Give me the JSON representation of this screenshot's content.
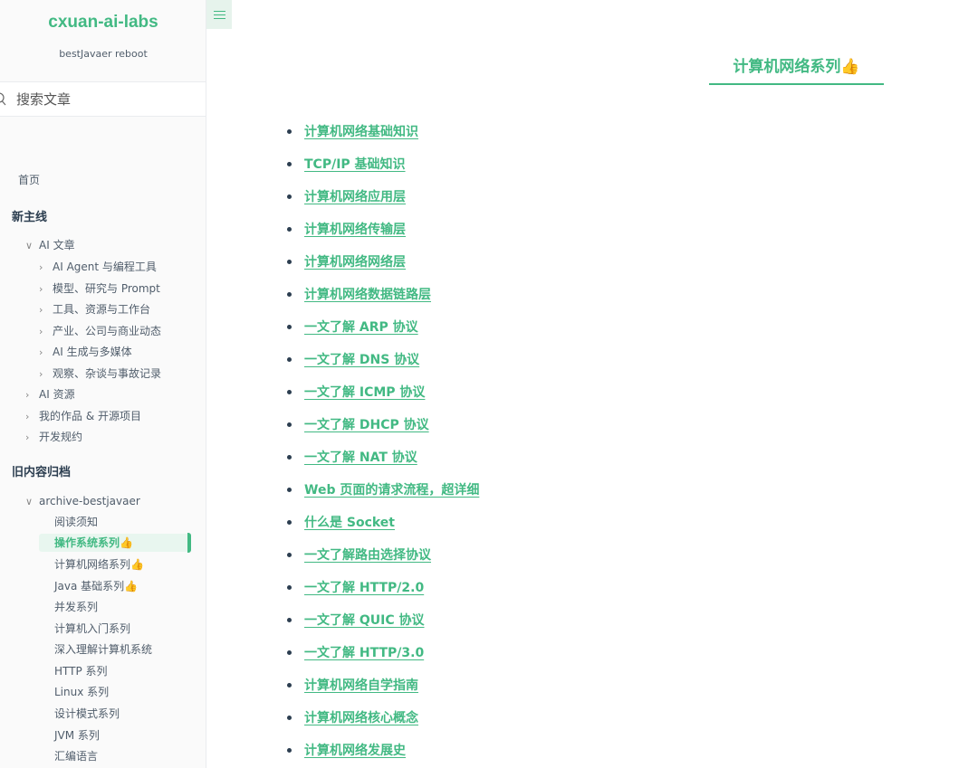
{
  "sidebar": {
    "brand": "cxuan-ai-labs",
    "subtitle": "bestJavaer reboot",
    "search_placeholder": "搜索文章",
    "home": "首页",
    "section_main": "新主线",
    "ai_articles": "AI 文章",
    "ai_sub": [
      "AI Agent 与编程工具",
      "模型、研究与 Prompt",
      "工具、资源与工作台",
      "产业、公司与商业动态",
      "AI 生成与多媒体",
      "观察、杂谈与事故记录"
    ],
    "ai_resources": "AI 资源",
    "my_works": "我的作品 & 开源项目",
    "dev_rules": "开发规约",
    "section_archive": "旧内容归档",
    "archive_name": "archive-bestjavaer",
    "archive_items": [
      "阅读须知",
      "操作系统系列👍",
      "计算机网络系列👍",
      "Java 基础系列👍",
      "并发系列",
      "计算机入门系列",
      "深入理解计算机系统",
      "HTTP 系列",
      "Linux 系列",
      "设计模式系列",
      "JVM 系列",
      "汇编语言"
    ]
  },
  "main": {
    "title": "计算机网络系列👍",
    "articles": [
      "计算机网络基础知识",
      "TCP/IP 基础知识",
      "计算机网络应用层",
      "计算机网络传输层",
      "计算机网络网络层",
      "计算机网络数据链路层",
      "一文了解 ARP 协议",
      "一文了解 DNS 协议",
      "一文了解 ICMP 协议",
      "一文了解 DHCP 协议",
      "一文了解 NAT 协议",
      "Web 页面的请求流程，超详细",
      "什么是 Socket",
      "一文了解路由选择协议",
      "一文了解 HTTP/2.0",
      "一文了解 QUIC 协议",
      "一文了解 HTTP/3.0",
      "计算机网络自学指南",
      "计算机网络核心概念",
      "计算机网络发展史"
    ]
  },
  "colors": {
    "accent": "#42b983",
    "text": "#2c3e50",
    "sidebar_bg": "#fafafa"
  },
  "icons": {
    "search": "search-icon",
    "menu": "hamburger-menu-icon",
    "expand": "chevron-right-icon",
    "collapse": "chevron-down-icon"
  }
}
